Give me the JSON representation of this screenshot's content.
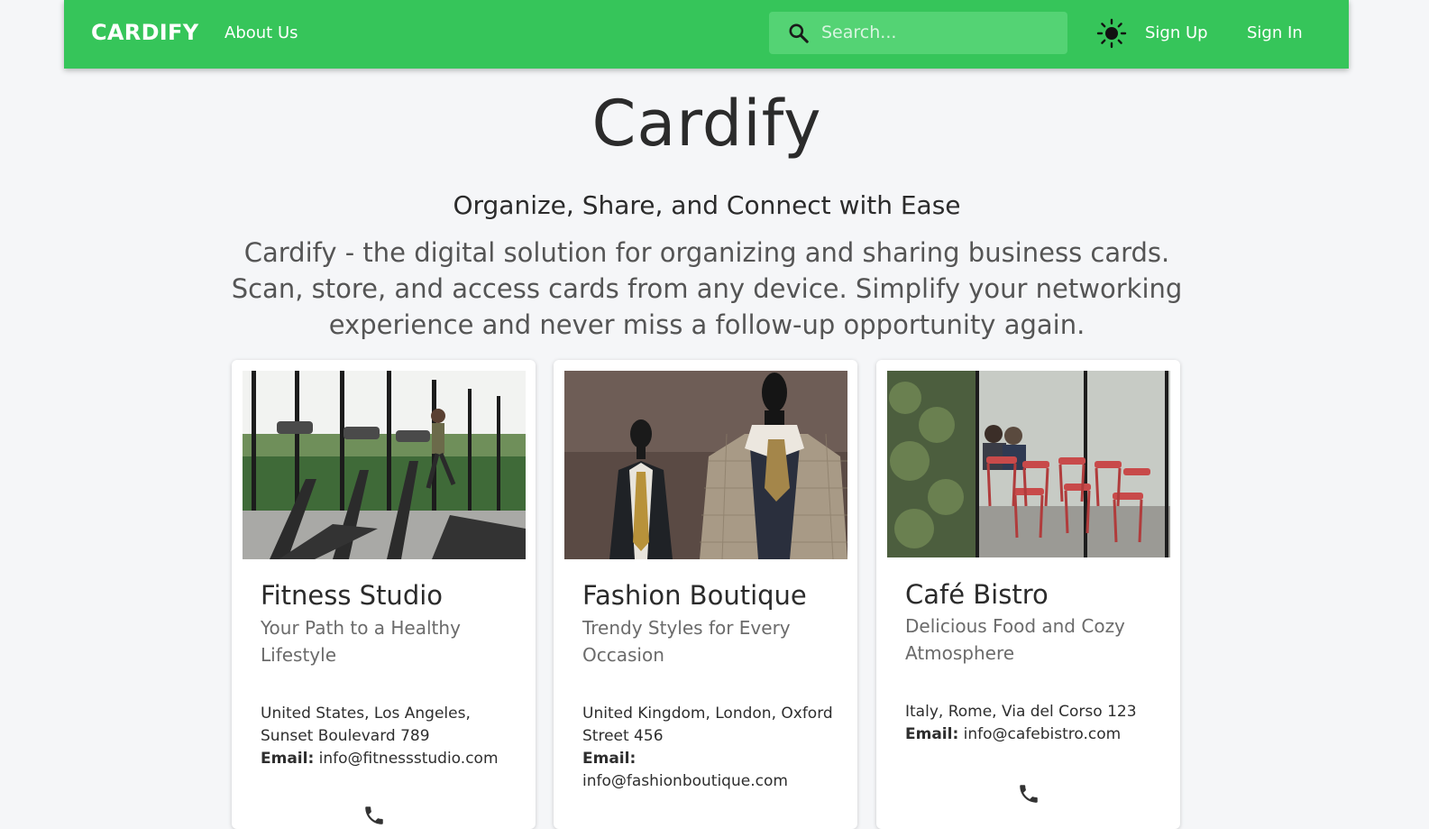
{
  "navbar": {
    "brand": "CARDIFY",
    "about_label": "About Us",
    "search_placeholder": "Search...",
    "signup_label": "Sign Up",
    "signin_label": "Sign In",
    "bg_color": "#36c55a"
  },
  "hero": {
    "title": "Cardify",
    "subtitle": "Organize, Share, and Connect with Ease",
    "description": "Cardify - the digital solution for organizing and sharing business cards. Scan, store, and access cards from any device. Simplify your networking experience and never miss a follow-up opportunity again."
  },
  "cards": [
    {
      "title": "Fitness Studio",
      "subtitle": "Your Path to a Healthy Lifestyle",
      "address": "United States, Los Angeles, Sunset Boulevard 789",
      "email_label": "Email:",
      "email": "info@fitnessstudio.com",
      "image_icon": "gym-treadmill-photo"
    },
    {
      "title": "Fashion Boutique",
      "subtitle": "Trendy Styles for Every Occasion",
      "address": "United Kingdom, London, Oxford Street 456",
      "email_label": "Email:",
      "email": "info@fashionboutique.com",
      "image_icon": "suit-mannequin-photo"
    },
    {
      "title": "Café Bistro",
      "subtitle": "Delicious Food and Cozy Atmosphere",
      "address": "Italy, Rome, Via del Corso 123",
      "email_label": "Email:",
      "email": "info@cafebistro.com",
      "image_icon": "cafe-terrace-photo"
    }
  ]
}
